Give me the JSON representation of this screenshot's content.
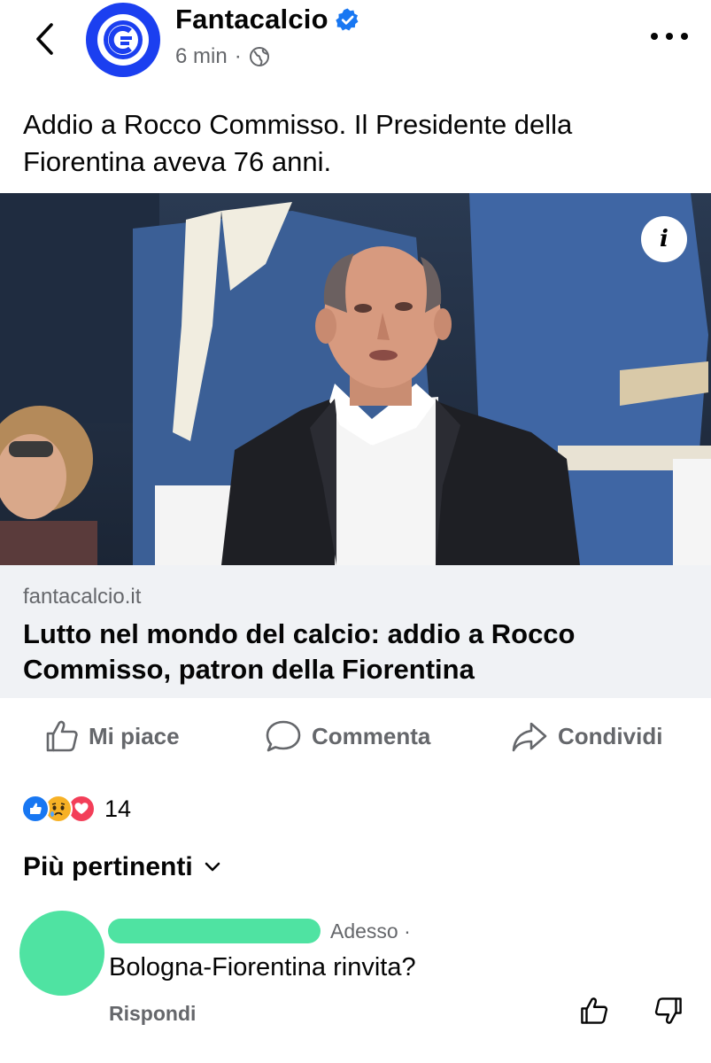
{
  "header": {
    "page_name": "Fantacalcio",
    "time": "6 min",
    "separator": "·"
  },
  "post": {
    "text": "Addio a Rocco Commisso. Il Presidente della Fiorentina aveva 76 anni."
  },
  "link": {
    "domain": "fantacalcio.it",
    "title": "Lutto nel mondo del calcio: addio a Rocco Commisso, patron della Fiorentina"
  },
  "actions": {
    "like": "Mi piace",
    "comment": "Commenta",
    "share": "Condividi"
  },
  "reactions": {
    "count": "14",
    "icons": [
      "like-icon",
      "sad-icon",
      "love-icon"
    ]
  },
  "comments_sort": {
    "label": "Più pertinenti"
  },
  "comment": {
    "time": "Adesso ·",
    "text": "Bologna-Fiorentina rinvita?",
    "reply": "Rispondi"
  },
  "colors": {
    "brand_blue": "#1b3ff0",
    "facebook_blue": "#1877f2",
    "love_red": "#f33e58",
    "sad_yellow": "#f7b125",
    "redaction_green": "#4fe3a2",
    "secondary_text": "#65676b"
  }
}
